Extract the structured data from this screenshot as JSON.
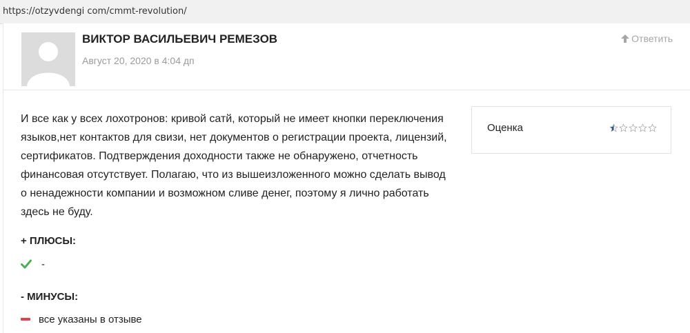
{
  "address_bar": {
    "url": "https://otzyvdengi com/cmmt-revolution/"
  },
  "comment": {
    "author": "ВИКТОР ВАСИЛЬЕВИЧ РЕМЕЗОВ",
    "date": "Август 20, 2020 в 4:04 дп",
    "reply_label": "Ответить",
    "text": "И все как у всех лохотронов: кривой сатй, который не имеет кнопки переключения языков,нет контактов для свизи, нет документов о регистрации проекта, лицензий, сертификатов. Подтверждения доходности также не обнаружено, отчетность финансовая отсутствует. Полагаю, что из вышеизложенного можно сделать вывод о ненадежности компании и возможном сливе денег, поэтому я лично работать здесь не буду.",
    "rating": {
      "label": "Оценка",
      "value": 0.5,
      "max": 5,
      "star_color": "#1f4f8f"
    },
    "pros": {
      "title": "+ ПЛЮСЫ:",
      "items": [
        "-"
      ],
      "icon": "check-icon",
      "icon_color": "#4caf50"
    },
    "cons": {
      "title": "- МИНУСЫ:",
      "items": [
        "все указаны в отзыве"
      ],
      "icon": "minus-icon",
      "icon_color": "#e0414a"
    }
  }
}
